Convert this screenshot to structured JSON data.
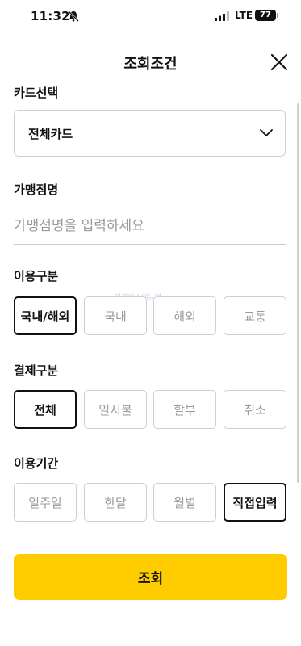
{
  "status_bar": {
    "time": "11:32",
    "network": "LTE",
    "battery": "77"
  },
  "header": {
    "title": "조회조건"
  },
  "card_select": {
    "label": "카드선택",
    "value": "전체카드"
  },
  "merchant": {
    "label": "가맹점명",
    "placeholder": "가맹점명을 입력하세요",
    "value": ""
  },
  "usage_type": {
    "label": "이용구분",
    "options": [
      "국내/해외",
      "국내",
      "해외",
      "교통"
    ],
    "selected": "국내/해외"
  },
  "payment_type": {
    "label": "결제구분",
    "options": [
      "전체",
      "일시불",
      "할부",
      "취소"
    ],
    "selected": "전체"
  },
  "period": {
    "label": "이용기간",
    "options": [
      "일주일",
      "한달",
      "월별",
      "직접입력"
    ],
    "selected": "직접입력"
  },
  "watermark": "마케이스매뉴얼",
  "submit": {
    "label": "조회"
  },
  "colors": {
    "accent": "#FFCC00",
    "text": "#111111",
    "muted": "#9A9A9A",
    "border": "#CFCFCF"
  }
}
